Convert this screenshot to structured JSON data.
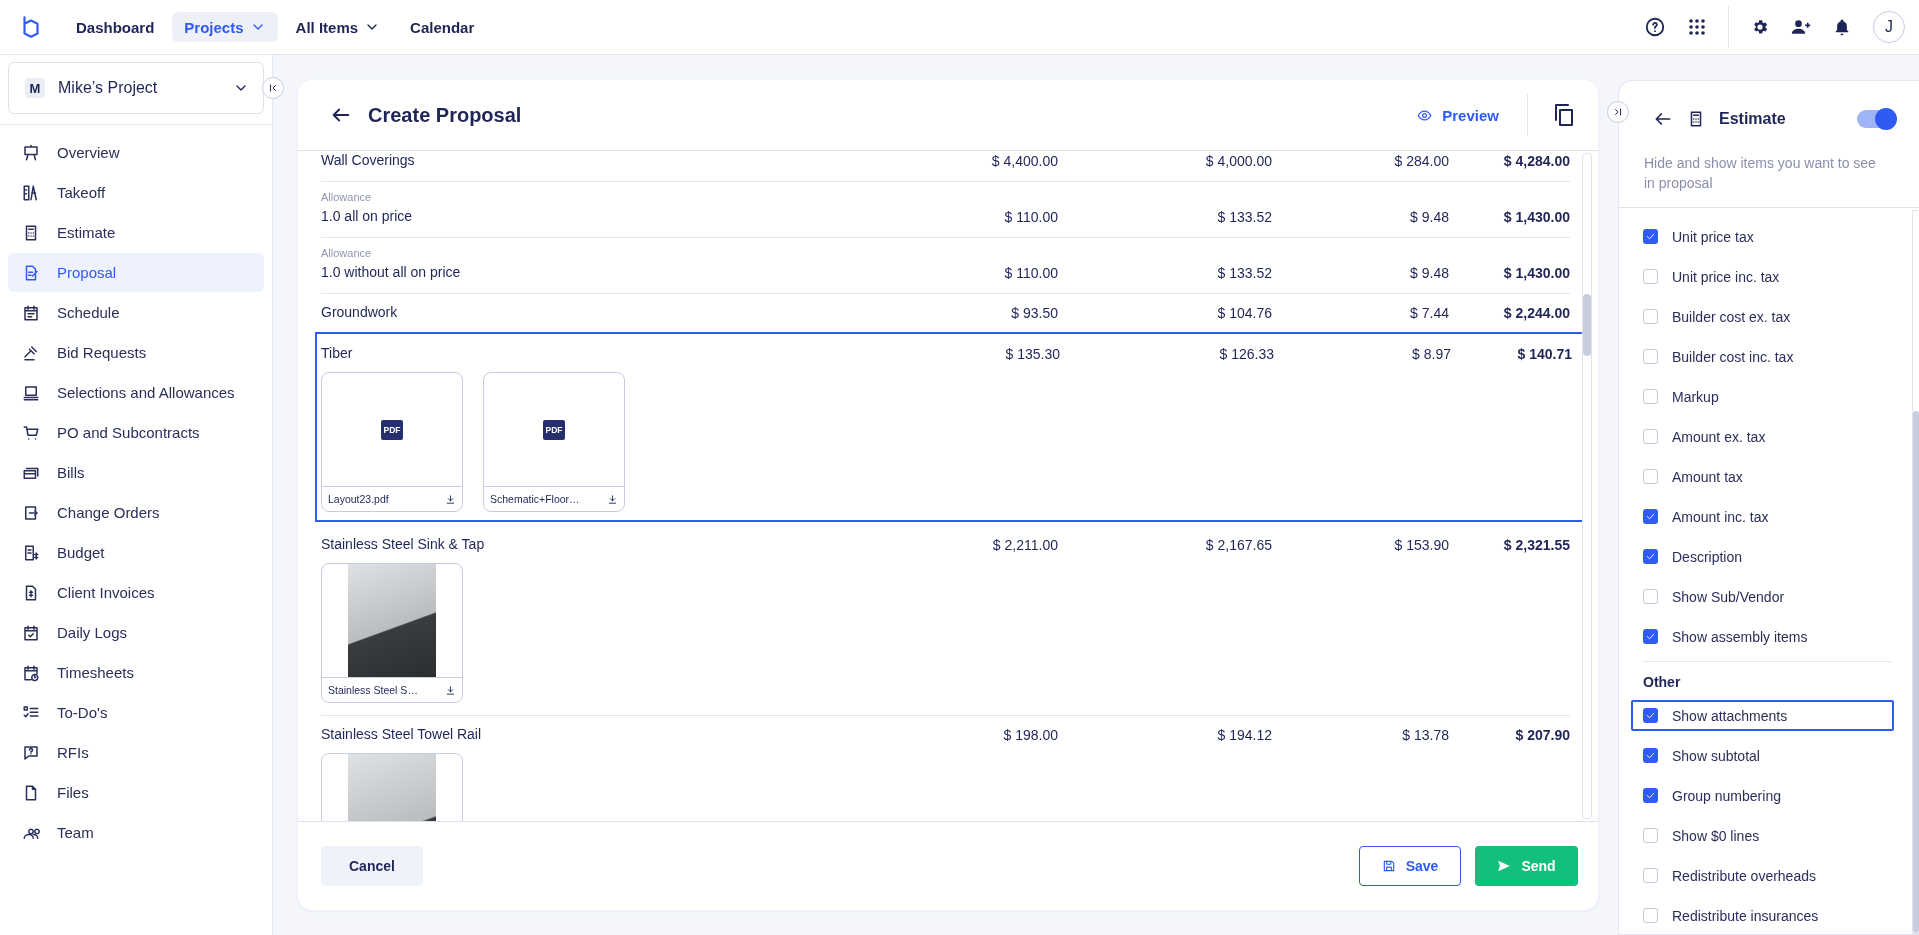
{
  "topbar": {
    "nav": [
      {
        "label": "Dashboard",
        "selected": false,
        "dropdown": false
      },
      {
        "label": "Projects",
        "selected": true,
        "dropdown": true
      },
      {
        "label": "All Items",
        "selected": false,
        "dropdown": true
      },
      {
        "label": "Calendar",
        "selected": false,
        "dropdown": false
      }
    ],
    "avatar": "J"
  },
  "sidebar": {
    "project": {
      "badge": "M",
      "name": "Mike’s Project"
    },
    "items": [
      {
        "label": "Overview",
        "selected": false
      },
      {
        "label": "Takeoff",
        "selected": false
      },
      {
        "label": "Estimate",
        "selected": false
      },
      {
        "label": "Proposal",
        "selected": true
      },
      {
        "label": "Schedule",
        "selected": false
      },
      {
        "label": "Bid Requests",
        "selected": false
      },
      {
        "label": "Selections and Allowances",
        "selected": false
      },
      {
        "label": "PO and Subcontracts",
        "selected": false
      },
      {
        "label": "Bills",
        "selected": false
      },
      {
        "label": "Change Orders",
        "selected": false
      },
      {
        "label": "Budget",
        "selected": false
      },
      {
        "label": "Client Invoices",
        "selected": false
      },
      {
        "label": "Daily Logs",
        "selected": false
      },
      {
        "label": "Timesheets",
        "selected": false
      },
      {
        "label": "To-Do's",
        "selected": false
      },
      {
        "label": "RFIs",
        "selected": false
      },
      {
        "label": "Files",
        "selected": false
      },
      {
        "label": "Team",
        "selected": false
      }
    ]
  },
  "proposal": {
    "title": "Create Proposal",
    "preview": "Preview",
    "rows": [
      {
        "name": "Wall Coverings",
        "values": [
          "$ 4,400.00",
          "$ 4,000.00",
          "$ 284.00",
          "$ 4,284.00"
        ],
        "highlighted": false
      },
      {
        "category": "Allowance",
        "name": "1.0 all on price",
        "values": [
          "$ 110.00",
          "$ 133.52",
          "$ 9.48",
          "$ 1,430.00"
        ],
        "highlighted": false
      },
      {
        "category": "Allowance",
        "name": "1.0 without all on price",
        "values": [
          "$ 110.00",
          "$ 133.52",
          "$ 9.48",
          "$ 1,430.00"
        ],
        "highlighted": false
      },
      {
        "name": "Groundwork",
        "values": [
          "$ 93.50",
          "$ 104.76",
          "$ 7.44",
          "$ 2,244.00"
        ],
        "highlighted": false
      },
      {
        "name": "Tiber",
        "values": [
          "$ 135.30",
          "$ 126.33",
          "$ 8.97",
          "$ 140.71"
        ],
        "highlighted": true,
        "attachments": [
          {
            "kind": "pdf",
            "badge": "PDF",
            "name": "Layout23.pdf"
          },
          {
            "kind": "pdf",
            "badge": "PDF",
            "name": "Schematic+Floor…"
          }
        ]
      },
      {
        "name": "Stainless Steel Sink & Tap",
        "values": [
          "$ 2,211.00",
          "$ 2,167.65",
          "$ 153.90",
          "$ 2,321.55"
        ],
        "highlighted": false,
        "attachments": [
          {
            "kind": "image",
            "name": "Stainless Steel S…"
          }
        ]
      },
      {
        "name": "Stainless Steel Towel Rail",
        "values": [
          "$ 198.00",
          "$ 194.12",
          "$ 13.78",
          "$ 207.90"
        ],
        "highlighted": false,
        "attachments": [
          {
            "kind": "image"
          }
        ]
      }
    ],
    "cancel": "Cancel",
    "save": "Save",
    "send": "Send"
  },
  "estimate_panel": {
    "title": "Estimate",
    "on": true,
    "hint": "Hide and show items you want to see in proposal",
    "options": [
      {
        "label": "Unit price tax",
        "checked": true,
        "highlighted": false
      },
      {
        "label": "Unit price inc. tax",
        "checked": false,
        "highlighted": false
      },
      {
        "label": "Builder cost ex. tax",
        "checked": false,
        "highlighted": false
      },
      {
        "label": "Builder cost inc. tax",
        "checked": false,
        "highlighted": false
      },
      {
        "label": "Markup",
        "checked": false,
        "highlighted": false
      },
      {
        "label": "Amount ex. tax",
        "checked": false,
        "highlighted": false
      },
      {
        "label": "Amount tax",
        "checked": false,
        "highlighted": false
      },
      {
        "label": "Amount inc. tax",
        "checked": true,
        "highlighted": false
      },
      {
        "label": "Description",
        "checked": true,
        "highlighted": false
      },
      {
        "label": "Show Sub/Vendor",
        "checked": false,
        "highlighted": false
      },
      {
        "label": "Show assembly items",
        "checked": true,
        "highlighted": false
      }
    ],
    "other_heading": "Other",
    "other_options": [
      {
        "label": "Show attachments",
        "checked": true,
        "highlighted": true
      },
      {
        "label": "Show subtotal",
        "checked": true,
        "highlighted": false
      },
      {
        "label": "Group numbering",
        "checked": true,
        "highlighted": false
      },
      {
        "label": "Show $0 lines",
        "checked": false,
        "highlighted": false
      },
      {
        "label": "Redistribute overheads",
        "checked": false,
        "highlighted": false
      },
      {
        "label": "Redistribute insurances",
        "checked": false,
        "highlighted": false
      }
    ]
  }
}
